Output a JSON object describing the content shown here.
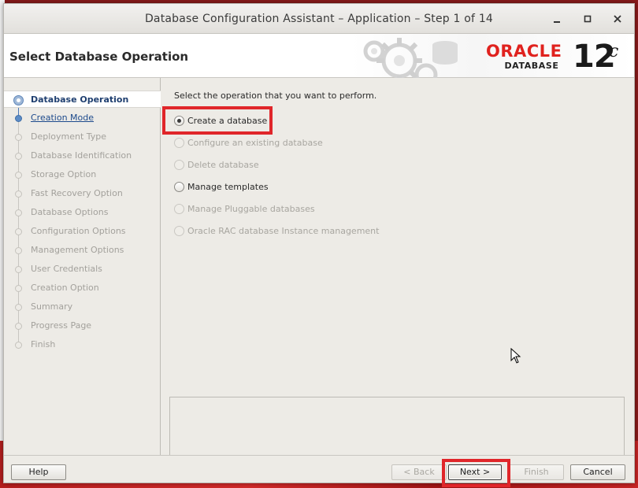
{
  "window": {
    "title": "Database Configuration Assistant – Application – Step 1 of 14",
    "controls": [
      "minimize",
      "maximize",
      "close"
    ]
  },
  "header": {
    "page_title": "Select Database Operation",
    "brand": "ORACLE",
    "brand_sub": "DATABASE",
    "version": "12",
    "version_sup": "c",
    "brand_color": "#e0221e"
  },
  "steps": [
    {
      "label": "Database Operation",
      "state": "current"
    },
    {
      "label": "Creation Mode",
      "state": "link"
    },
    {
      "label": "Deployment Type",
      "state": "disabled"
    },
    {
      "label": "Database Identification",
      "state": "disabled"
    },
    {
      "label": "Storage Option",
      "state": "disabled"
    },
    {
      "label": "Fast Recovery Option",
      "state": "disabled"
    },
    {
      "label": "Database Options",
      "state": "disabled"
    },
    {
      "label": "Configuration Options",
      "state": "disabled"
    },
    {
      "label": "Management Options",
      "state": "disabled"
    },
    {
      "label": "User Credentials",
      "state": "disabled"
    },
    {
      "label": "Creation Option",
      "state": "disabled"
    },
    {
      "label": "Summary",
      "state": "disabled"
    },
    {
      "label": "Progress Page",
      "state": "disabled"
    },
    {
      "label": "Finish",
      "state": "disabled"
    }
  ],
  "main": {
    "prompt": "Select the operation that you want to perform.",
    "options": [
      {
        "label": "Create a database",
        "checked": true,
        "enabled": true
      },
      {
        "label": "Configure an existing database",
        "checked": false,
        "enabled": false
      },
      {
        "label": "Delete database",
        "checked": false,
        "enabled": false
      },
      {
        "label": "Manage templates",
        "checked": false,
        "enabled": true
      },
      {
        "label": "Manage Pluggable databases",
        "checked": false,
        "enabled": false
      },
      {
        "label": "Oracle RAC database Instance management",
        "checked": false,
        "enabled": false
      }
    ]
  },
  "footer": {
    "help_label": "Help",
    "back_label": "< Back",
    "next_label": "Next >",
    "finish_label": "Finish",
    "cancel_label": "Cancel"
  },
  "highlight_color": "#e0262a"
}
